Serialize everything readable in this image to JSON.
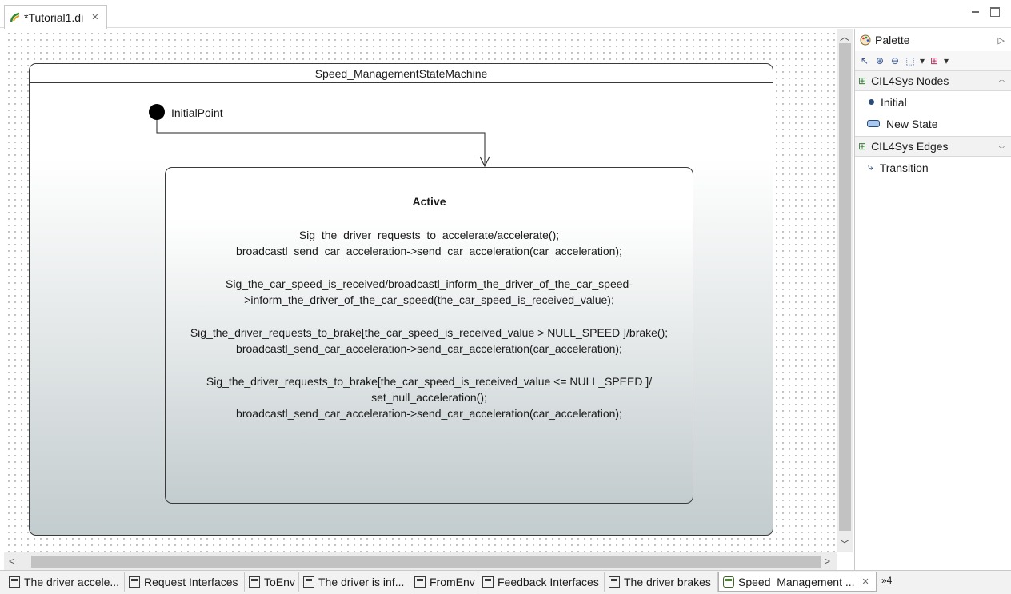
{
  "editor": {
    "tab_title": "*Tutorial1.di",
    "close_symbol": "✕",
    "icon": "papyrus-icon"
  },
  "diagram": {
    "state_machine_name": "Speed_ManagementStateMachine",
    "initial_point_label": "InitialPoint",
    "active_state": {
      "name": "Active",
      "behaviors": [
        [
          "Sig_the_driver_requests_to_accelerate/accelerate();",
          "broadcastl_send_car_acceleration->send_car_acceleration(car_acceleration);"
        ],
        [
          "Sig_the_car_speed_is_received/broadcastl_inform_the_driver_of_the_car_speed-",
          ">inform_the_driver_of_the_car_speed(the_car_speed_is_received_value);"
        ],
        [
          "Sig_the_driver_requests_to_brake[the_car_speed_is_received_value > NULL_SPEED  ]/brake();",
          "broadcastl_send_car_acceleration->send_car_acceleration(car_acceleration);"
        ],
        [
          "Sig_the_driver_requests_to_brake[the_car_speed_is_received_value <= NULL_SPEED  ]/",
          "set_null_acceleration();",
          "broadcastl_send_car_acceleration->send_car_acceleration(car_acceleration);"
        ]
      ]
    }
  },
  "palette": {
    "title": "Palette",
    "drawers": [
      {
        "label": "CIL4Sys Nodes",
        "entries": [
          "Initial",
          "New State"
        ]
      },
      {
        "label": "CIL4Sys Edges",
        "entries": [
          "Transition"
        ]
      }
    ]
  },
  "bottom_tabs": [
    "The driver accele...",
    "Request Interfaces",
    "ToEnv",
    "The driver is inf...",
    "FromEnv",
    "Feedback Interfaces",
    "The driver brakes",
    "Speed_Management ..."
  ],
  "overflow_label": "»4"
}
